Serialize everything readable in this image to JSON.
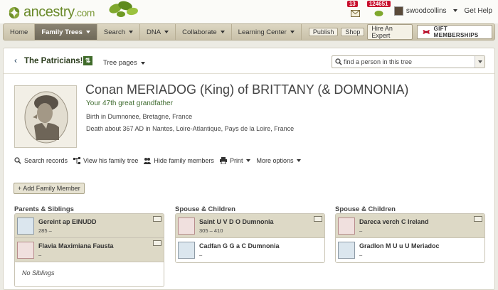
{
  "header": {
    "logo_text": "ancestry",
    "logo_suffix": ".com",
    "messages_count": "13",
    "hints_count": "124651",
    "username": "swoodcollins",
    "help_label": "Get Help"
  },
  "nav": {
    "items": [
      "Home",
      "Family Trees",
      "Search",
      "DNA",
      "Collaborate",
      "Learning Center"
    ],
    "publish": "Publish",
    "shop": "Shop",
    "hire": "Hire An Expert",
    "gift": "GIFT MEMBERSHIPS"
  },
  "tree": {
    "name": "The Patricians!",
    "pages_label": "Tree pages",
    "search_placeholder": "find a person in this tree"
  },
  "person": {
    "name": "Conan MERIADOG (King) of BRITTANY (& DOMNONIA)",
    "relation": "Your 47th great grandfather",
    "birth": "Birth in Dumnonee, Bretagne, France",
    "death": "Death about 367 AD in Nantes, Loire-Atlantique, Pays de la Loire, France"
  },
  "actions": {
    "search_records": "Search records",
    "view_tree": "View his family tree",
    "hide_members": "Hide family members",
    "print": "Print",
    "more": "More options"
  },
  "add_member": "+ Add Family Member",
  "parents": {
    "title": "Parents & Siblings",
    "cards": [
      {
        "name": "Gereint ap EINUDD",
        "dates": "285 –"
      },
      {
        "name": "Flavia Maximiana Fausta",
        "dates": "–"
      }
    ],
    "no_siblings": "No Siblings"
  },
  "family1": {
    "title": "Spouse & Children",
    "spouse": {
      "name": "Saint U V D O Dumnonia",
      "dates": "305 – 410"
    },
    "child": {
      "name": "Cadfan G G a C Dumnonia",
      "dates": "–"
    }
  },
  "family2": {
    "title": "Spouse & Children",
    "spouse": {
      "name": "Dareca verch C Ireland",
      "dates": "–"
    },
    "child": {
      "name": "Gradlon M U u U Meriadoc",
      "dates": "–"
    }
  }
}
